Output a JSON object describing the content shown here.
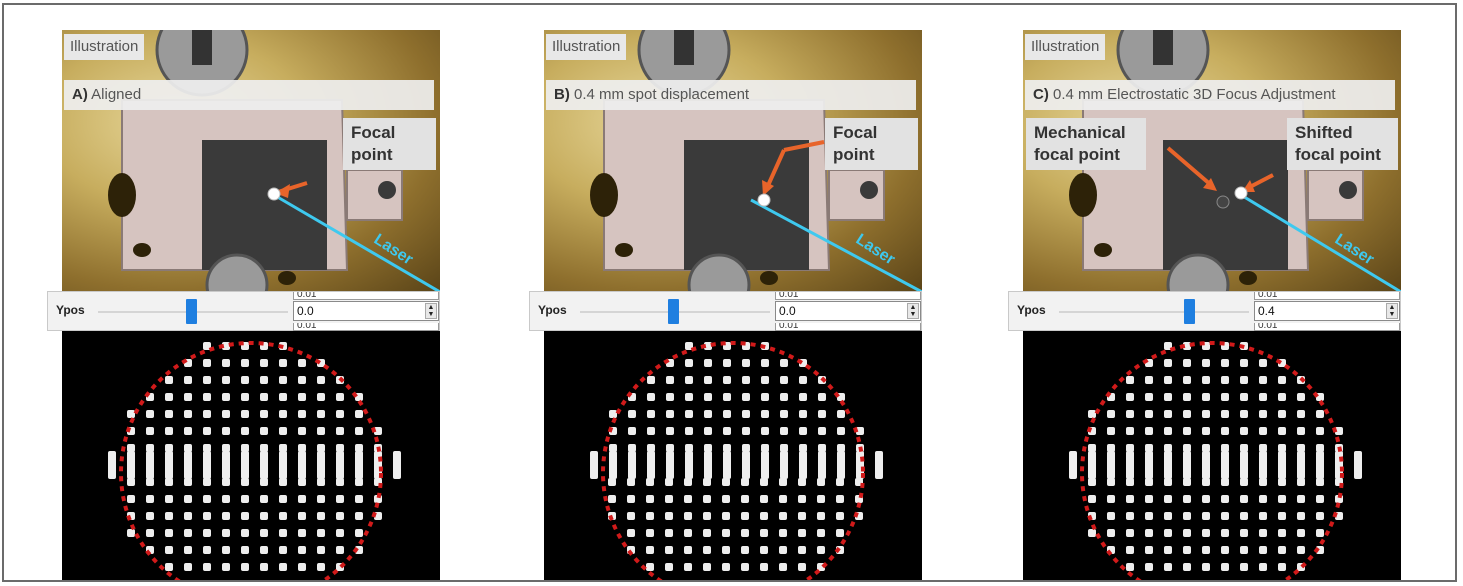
{
  "panels": [
    {
      "illustration_tag": "Illustration",
      "label_prefix": "A)",
      "label_text": " Aligned",
      "callouts": [
        "Focal\npoint"
      ],
      "laser_label": "Laser",
      "slider_name": "Ypos",
      "slider_value": "0.0",
      "slider_position": 0.5,
      "ghost_top_text": "0.01",
      "ghost_bottom_text": "0.01"
    },
    {
      "illustration_tag": "Illustration",
      "label_prefix": "B)",
      "label_text": " 0.4 mm spot displacement",
      "callouts": [
        "Focal\npoint"
      ],
      "laser_label": "Laser",
      "slider_name": "Ypos",
      "slider_value": "0.0",
      "slider_position": 0.5,
      "ghost_top_text": "0.01",
      "ghost_bottom_text": "0.01"
    },
    {
      "illustration_tag": "Illustration",
      "label_prefix": "C)",
      "label_text": " 0.4 mm Electrostatic 3D Focus Adjustment",
      "callouts": [
        "Mechanical\nfocal point",
        "Shifted\nfocal point"
      ],
      "laser_label": "Laser",
      "slider_name": "Ypos",
      "slider_value": "0.4",
      "slider_position": 0.68,
      "ghost_top_text": "0.01",
      "ghost_bottom_text": "0.01"
    }
  ],
  "colors": {
    "laser": "#3ec9ef",
    "callout_arrow": "#e8642a",
    "dashed_circle": "#d11a1a",
    "slider_thumb": "#1f7fe0"
  }
}
